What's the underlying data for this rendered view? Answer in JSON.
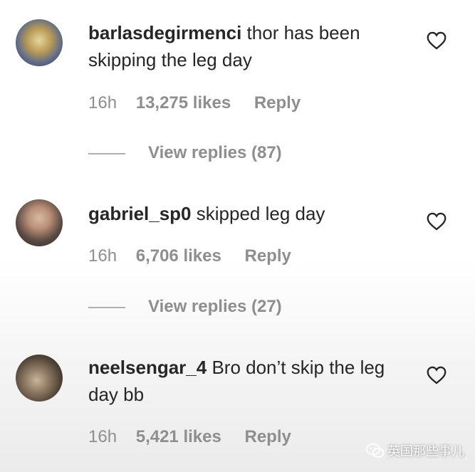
{
  "comments": [
    {
      "username": "barlasdegirmenci",
      "text": "thor has been skipping the leg day",
      "time": "16h",
      "likes": "13,275 likes",
      "reply": "Reply",
      "view_replies": "View replies (87)",
      "avatar_icon": "avatar-photo"
    },
    {
      "username": "gabriel_sp0",
      "text": "skipped leg day",
      "time": "16h",
      "likes": "6,706 likes",
      "reply": "Reply",
      "view_replies": "View replies (27)",
      "avatar_icon": "avatar-photo"
    },
    {
      "username": "neelsengar_4",
      "text": "Bro don’t skip the leg day bb",
      "time": "16h",
      "likes": "5,421 likes",
      "reply": "Reply",
      "avatar_icon": "avatar-photo"
    }
  ],
  "icons": {
    "like": "heart-outline-icon",
    "watermark": "wechat-icon"
  },
  "watermark": {
    "text": "英国那些事儿"
  },
  "colors": {
    "text": "#262626",
    "meta": "#8e8e8e",
    "background": "#ffffff"
  }
}
